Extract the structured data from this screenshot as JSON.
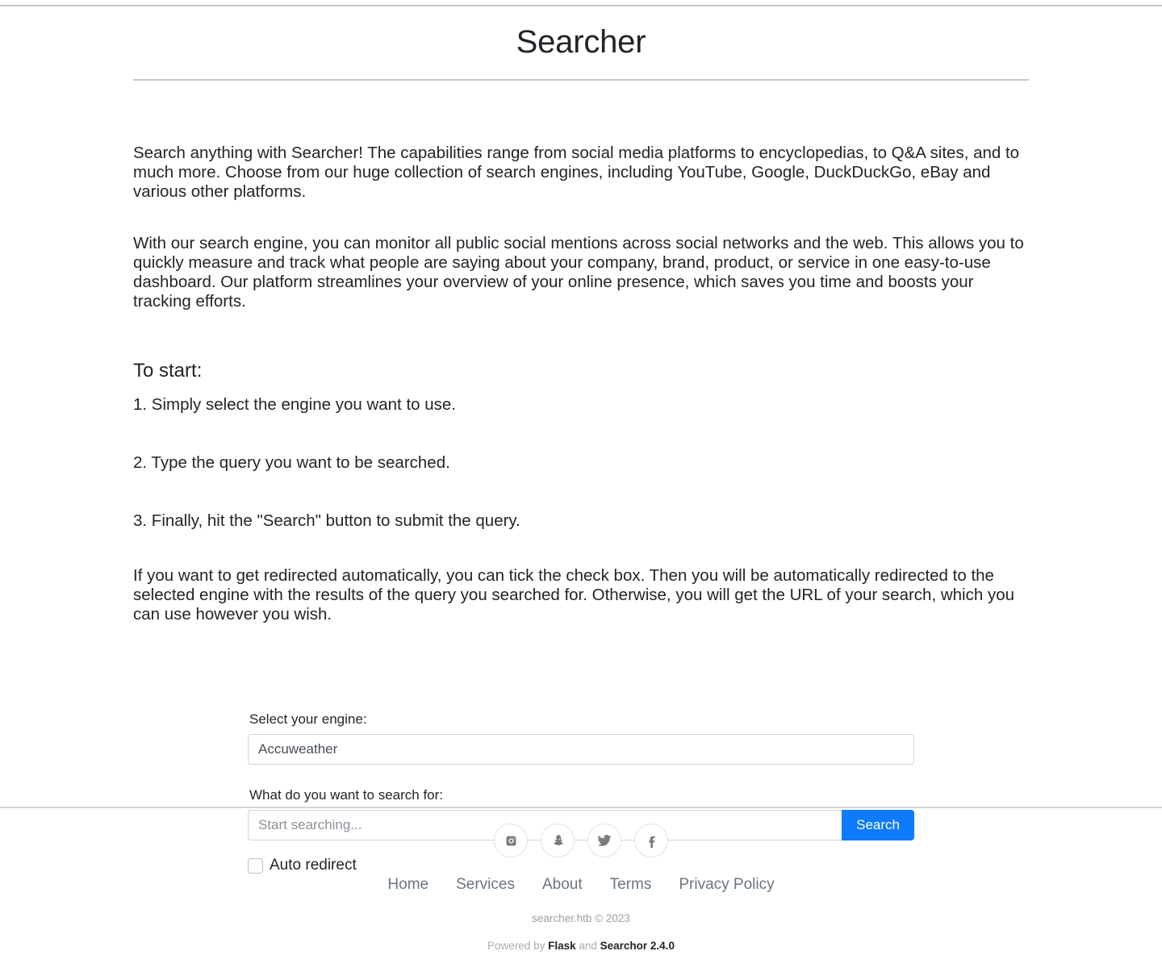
{
  "header": {
    "title": "Searcher"
  },
  "intro": {
    "paragraph_1": "Search anything with Searcher! The capabilities range from social media platforms to encyclopedias, to Q&A sites, and to much more. Choose from our huge collection of search engines, including YouTube, Google, DuckDuckGo, eBay and various other platforms.",
    "paragraph_2": "With our search engine, you can monitor all public social mentions across social networks and the web. This allows you to quickly measure and track what people are saying about your company, brand, product, or service in one easy-to-use dashboard. Our platform streamlines your overview of your online presence, which saves you time and boosts your tracking efforts."
  },
  "instructions": {
    "heading": "To start:",
    "steps": [
      "1. Simply select the engine you want to use.",
      "2. Type the query you want to be searched.",
      "3. Finally, hit the \"Search\" button to submit the query."
    ],
    "note": "If you want to get redirected automatically, you can tick the check box. Then you will be automatically redirected to the selected engine with the results of the query you searched for. Otherwise, you will get the URL of your search, which you can use however you wish."
  },
  "form": {
    "engine_label": "Select your engine:",
    "engine_selected": "Accuweather",
    "engine_options": [
      "Accuweather"
    ],
    "query_label": "What do you want to search for:",
    "query_value": "",
    "query_placeholder": "Start searching...",
    "search_button": "Search",
    "auto_redirect_label": "Auto redirect",
    "auto_redirect_checked": false,
    "accent_color": "#0d7bfc"
  },
  "footer": {
    "social": [
      {
        "name": "instagram-icon",
        "label": "Instagram"
      },
      {
        "name": "snapchat-icon",
        "label": "Snapchat"
      },
      {
        "name": "twitter-icon",
        "label": "Twitter"
      },
      {
        "name": "facebook-icon",
        "label": "Facebook"
      }
    ],
    "nav": [
      {
        "label": "Home"
      },
      {
        "label": "Services"
      },
      {
        "label": "About"
      },
      {
        "label": "Terms"
      },
      {
        "label": "Privacy Policy"
      }
    ],
    "copyright": "searcher.htb © 2023",
    "powered_prefix": "Powered by ",
    "powered_framework": "Flask",
    "powered_joiner": " and ",
    "powered_library": "Searchor 2.4.0"
  }
}
